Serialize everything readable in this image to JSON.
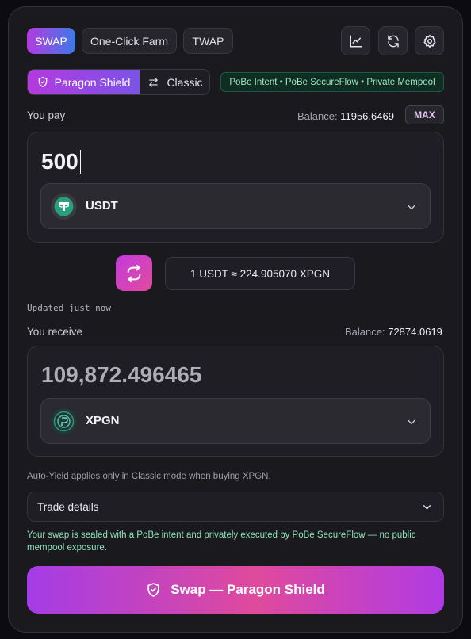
{
  "tabs": [
    {
      "label": "SWAP",
      "active": true
    },
    {
      "label": "One-Click Farm",
      "active": false
    },
    {
      "label": "TWAP",
      "active": false
    }
  ],
  "toolbar_icons": [
    "chart-icon",
    "refresh-icon",
    "settings-icon"
  ],
  "mode": {
    "shield_label": "Paragon Shield",
    "classic_label": "Classic",
    "selected": "Paragon Shield"
  },
  "badge": "PoBe Intent • PoBe SecureFlow • Private Mempool",
  "pay": {
    "label": "You pay",
    "balance_label": "Balance:",
    "balance_value": "11956.6469",
    "max_label": "MAX",
    "amount": "500",
    "token": "USDT"
  },
  "rate": {
    "text": "1 USDT ≈ 224.905070 XPGN",
    "updated": "Updated just now"
  },
  "receive": {
    "label": "You receive",
    "balance_label": "Balance:",
    "balance_value": "72874.0619",
    "amount": "109,872.496465",
    "token": "XPGN"
  },
  "note": "Auto-Yield applies only in Classic mode when buying XPGN.",
  "trade_details_label": "Trade details",
  "privacy_notice": "Your swap is sealed with a PoBe intent and privately executed by PoBe SecureFlow — no public mempool exposure.",
  "submit_label": "Swap — Paragon Shield",
  "colors": {
    "accent_purple": "#b43ae0",
    "accent_blue": "#3c7ae6",
    "accent_pink": "#e04a9c",
    "success_green": "#9ee6c0",
    "usdt_green": "#26a17b"
  }
}
